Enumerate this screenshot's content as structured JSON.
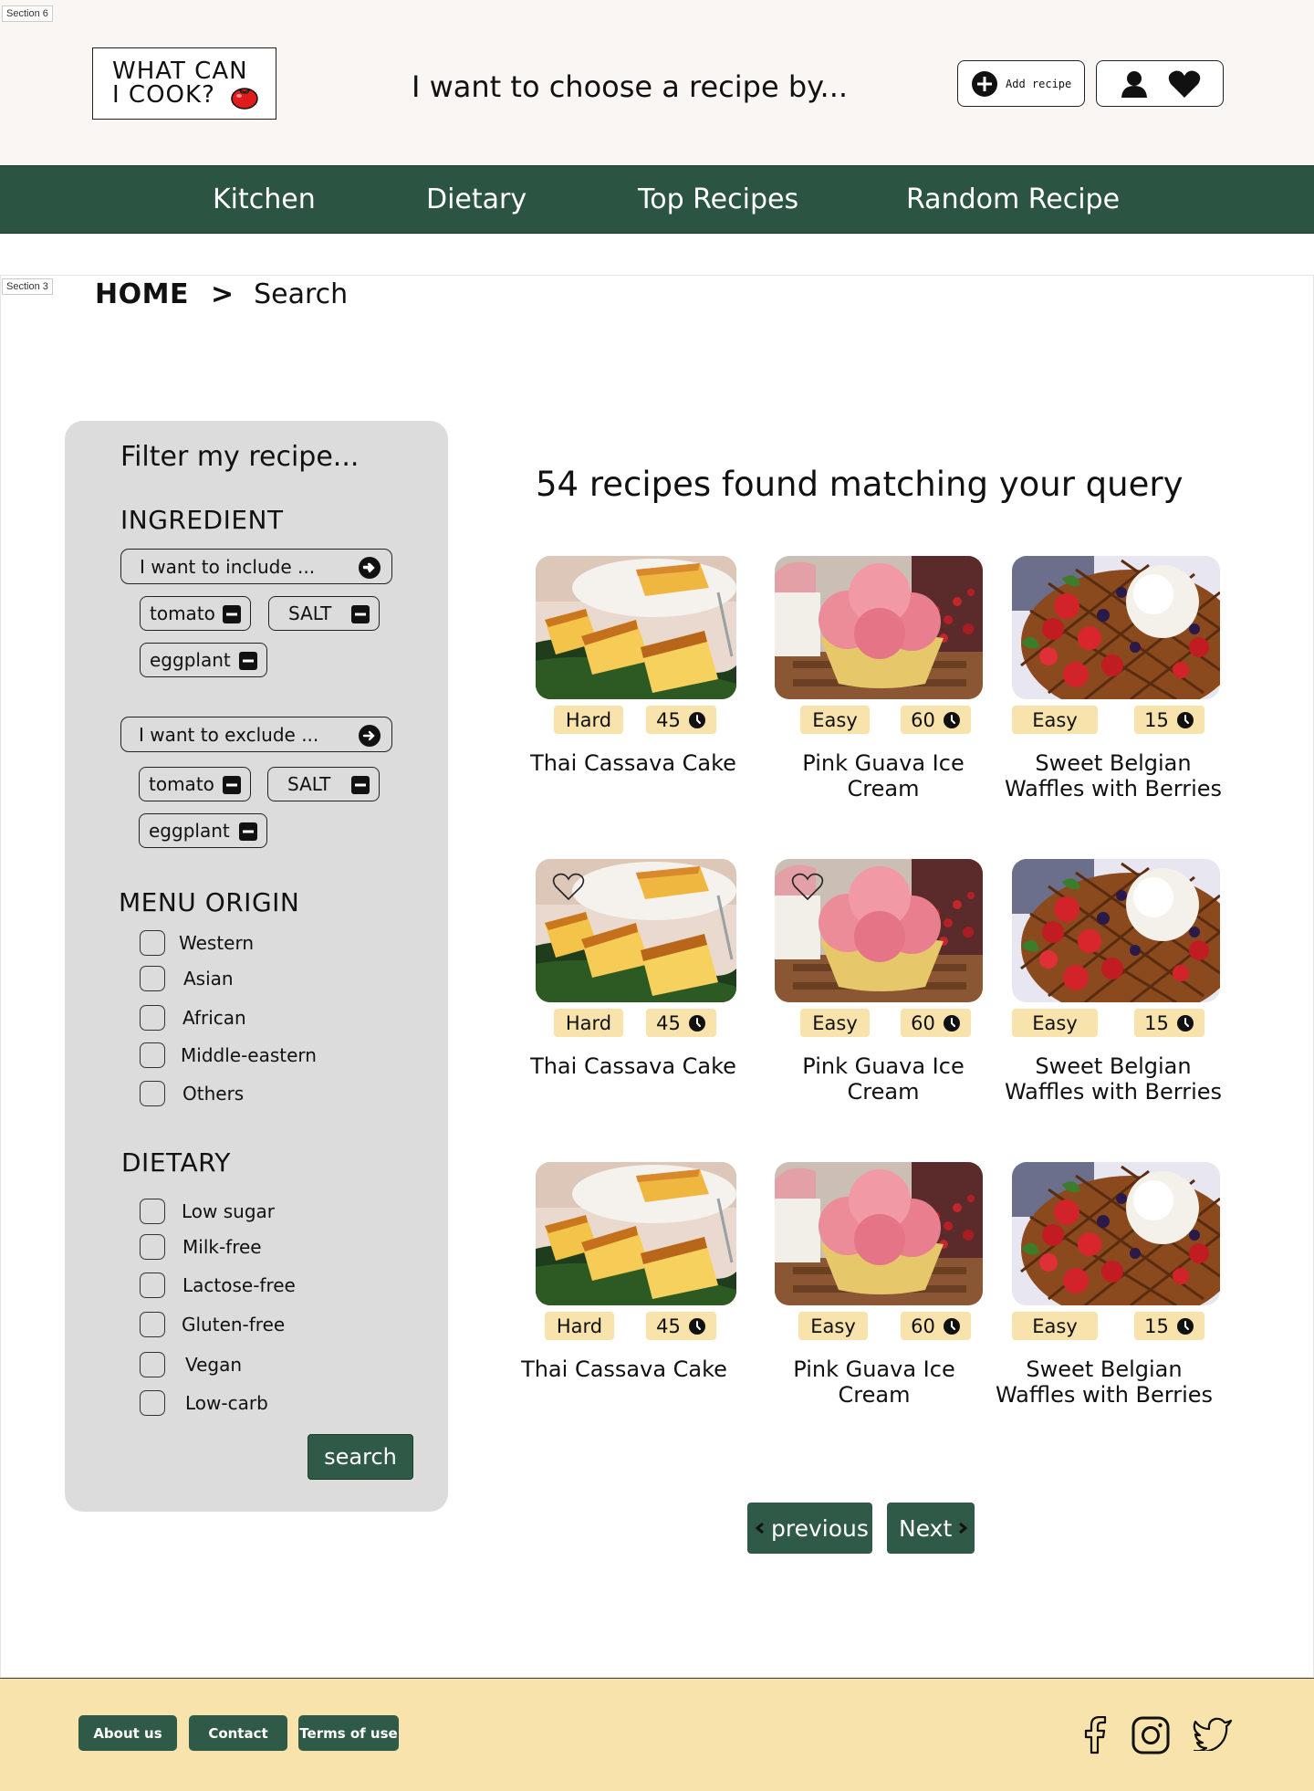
{
  "section_tags": {
    "top": "Section 6",
    "content": "Section 3"
  },
  "header": {
    "logo_line1": "WHAT CAN",
    "logo_line2": "I COOK?",
    "tagline": "I want to choose a recipe by...",
    "add_recipe_label": "Add recipe",
    "icons": [
      "plus-circle-icon",
      "user-icon",
      "heart-icon"
    ]
  },
  "nav": {
    "items": [
      {
        "label": "Kitchen"
      },
      {
        "label": "Dietary"
      },
      {
        "label": "Top Recipes"
      },
      {
        "label": "Random Recipe"
      }
    ]
  },
  "breadcrumb": {
    "home": "HOME",
    "separator": ">",
    "current": "Search"
  },
  "sidebar": {
    "title": "Filter my recipe...",
    "ingredient": {
      "heading": "INGREDIENT",
      "include_placeholder": "I want to include ...",
      "include_chips": [
        "tomato",
        "SALT",
        "eggplant"
      ],
      "exclude_placeholder": "I want to exclude ...",
      "exclude_chips": [
        "tomato",
        "SALT",
        "eggplant"
      ]
    },
    "menu_origin": {
      "heading": "MENU ORIGIN",
      "options": [
        "Western",
        "Asian",
        "African",
        "Middle-eastern",
        "Others"
      ]
    },
    "dietary": {
      "heading": "DIETARY",
      "options": [
        "Low sugar",
        "Milk-free",
        "Lactose-free",
        "Gluten-free",
        "Vegan",
        "Low-carb"
      ]
    },
    "search_label": "search"
  },
  "results": {
    "count_text": "54 recipes found matching your query",
    "recipes": [
      {
        "title": "Thai Cassava Cake",
        "difficulty": "Hard",
        "time": "45",
        "image": "cassava-cake"
      },
      {
        "title": "Pink Guava Ice Cream",
        "difficulty": "Easy",
        "time": "60",
        "image": "ice-cream"
      },
      {
        "title_line1": "Sweet Belgian",
        "title_line2": "Waffles with Berries",
        "difficulty": "Easy",
        "time": "15",
        "image": "waffles"
      },
      {
        "title": "Thai Cassava Cake",
        "difficulty": "Hard",
        "time": "45",
        "image": "cassava-cake"
      },
      {
        "title": "Pink Guava Ice Cream",
        "difficulty": "Easy",
        "time": "60",
        "image": "ice-cream"
      },
      {
        "title_line1": "Sweet Belgian",
        "title_line2": "Waffles with Berries",
        "difficulty": "Easy",
        "time": "15",
        "image": "waffles"
      },
      {
        "title": "Thai Cassava Cake",
        "difficulty": "Hard",
        "time": "45",
        "image": "cassava-cake"
      },
      {
        "title": "Pink Guava Ice Cream",
        "difficulty": "Easy",
        "time": "60",
        "image": "ice-cream"
      },
      {
        "title_line1": "Sweet Belgian",
        "title_line2": "Waffles with Berries",
        "difficulty": "Easy",
        "time": "15",
        "image": "waffles"
      }
    ]
  },
  "pagination": {
    "previous_label": "previous",
    "next_label": "Next"
  },
  "footer": {
    "links": [
      "About us",
      "Contact",
      "Terms of use"
    ],
    "social_icons": [
      "facebook-icon",
      "instagram-icon",
      "twitter-icon"
    ]
  },
  "colors": {
    "brand_green": "#2c5443",
    "tag_yellow": "#f7e3ab",
    "sidebar_gray": "#dcdcdc",
    "header_bg": "#faf6f4"
  }
}
